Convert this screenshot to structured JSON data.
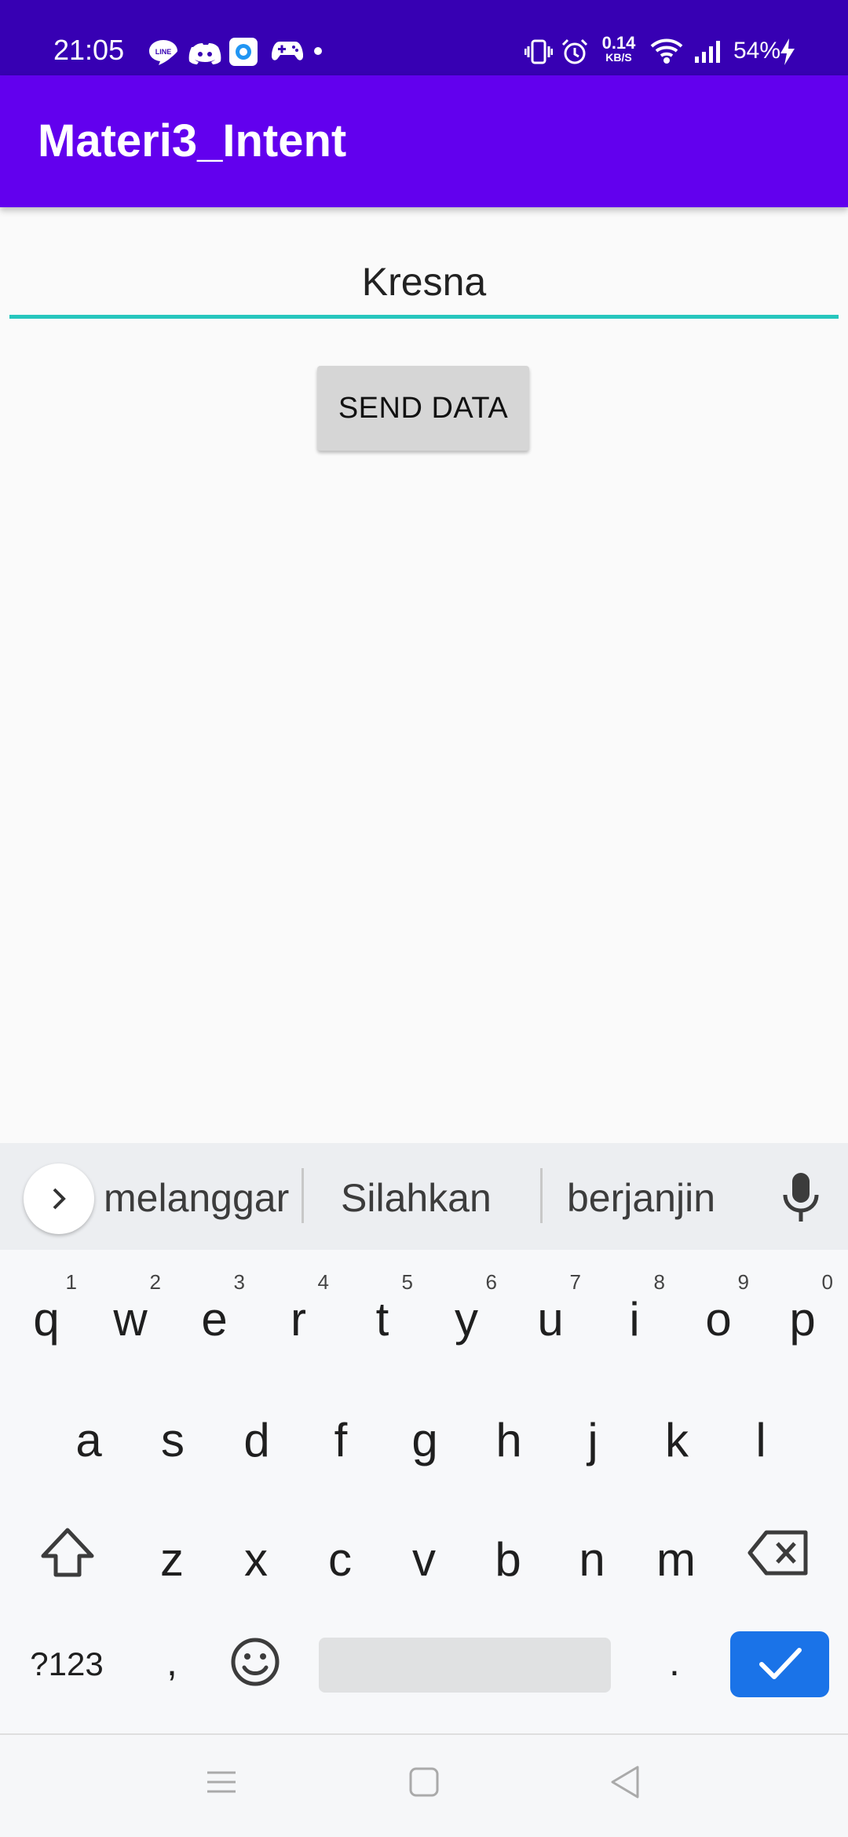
{
  "status_bar": {
    "time": "21:05",
    "net_speed_value": "0.14",
    "net_speed_unit": "KB/S",
    "battery": "54%",
    "notification_icons": [
      "line-icon",
      "discord-icon",
      "browser-icon",
      "gamepad-icon",
      "more-dot-icon"
    ],
    "system_icons": [
      "vibrate-icon",
      "alarm-icon",
      "wifi-icon",
      "signal-icon",
      "charging-icon"
    ]
  },
  "app_bar": {
    "title": "Materi3_Intent"
  },
  "form": {
    "name_value": "Kresna",
    "send_label": "SEND DATA"
  },
  "keyboard": {
    "suggestions": [
      "melanggar",
      "Silahkan",
      "berjanjin"
    ],
    "row1": [
      {
        "ch": "q",
        "num": "1"
      },
      {
        "ch": "w",
        "num": "2"
      },
      {
        "ch": "e",
        "num": "3"
      },
      {
        "ch": "r",
        "num": "4"
      },
      {
        "ch": "t",
        "num": "5"
      },
      {
        "ch": "y",
        "num": "6"
      },
      {
        "ch": "u",
        "num": "7"
      },
      {
        "ch": "i",
        "num": "8"
      },
      {
        "ch": "o",
        "num": "9"
      },
      {
        "ch": "p",
        "num": "0"
      }
    ],
    "row2": [
      "a",
      "s",
      "d",
      "f",
      "g",
      "h",
      "j",
      "k",
      "l"
    ],
    "row3": [
      "z",
      "x",
      "c",
      "v",
      "b",
      "n",
      "m"
    ],
    "symbols_label": "?123",
    "comma_label": ",",
    "period_label": "."
  },
  "colors": {
    "status_bar": "#3700b3",
    "app_bar": "#6200ee",
    "field_underline": "#26c6bd",
    "enter_key": "#1a73e8"
  }
}
